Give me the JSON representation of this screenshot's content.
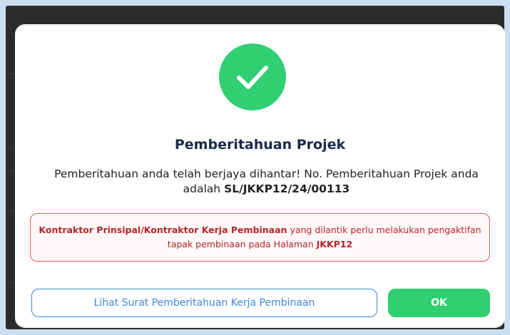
{
  "modal": {
    "title": "Pemberitahuan Projek",
    "message_prefix": "Pemberitahuan anda telah berjaya dihantar! No. Pemberitahuan Projek anda adalah ",
    "reference_number": "SL/JKKP12/24/00113",
    "notice": {
      "bold_start": "Kontraktor Prinsipal/Kontraktor Kerja Pembinaan",
      "middle": " yang dilantik perlu melakukan pengaktifan tapak pembinaan pada Halaman ",
      "bold_end": "JKKP12"
    },
    "buttons": {
      "view_letter": "Lihat Surat Pemberitahuan Kerja Pembinaan",
      "ok": "OK"
    }
  },
  "colors": {
    "success": "#2fcf72",
    "title": "#172a48",
    "warning_text": "#b3262a",
    "warning_border": "#e05858",
    "link_blue": "#3f86d8"
  },
  "icons": {
    "success": "check-circle-icon"
  }
}
